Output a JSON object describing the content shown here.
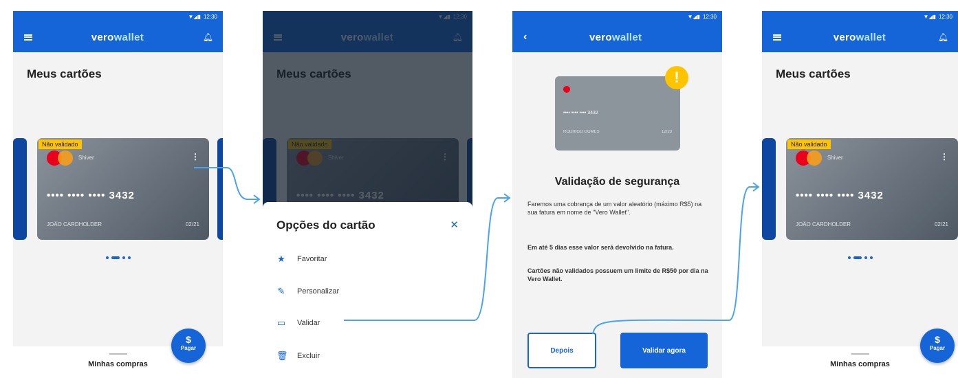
{
  "status": {
    "time": "12:30",
    "icons": "▼◢▮"
  },
  "brand": {
    "logo_a": "vero",
    "logo_b": "wallet"
  },
  "cards_screen": {
    "title": "Meus cartões",
    "card": {
      "badge": "Não validado",
      "brand_text": "Shiver",
      "number": "•••• •••• •••• 3432",
      "holder": "JOÃO CARDHOLDER",
      "expiry": "02/21"
    },
    "bottom_label": "Minhas compras",
    "fab_symbol": "$",
    "fab_label": "Pagar"
  },
  "options_sheet": {
    "title": "Opções do cartão",
    "close": "✕",
    "options": [
      {
        "icon": "star-icon",
        "label": "Favoritar"
      },
      {
        "icon": "pencil-icon",
        "label": "Personalizar"
      },
      {
        "icon": "card-icon",
        "label": "Validar"
      },
      {
        "icon": "trash-icon",
        "label": "Excluir"
      }
    ]
  },
  "validation": {
    "card_number": "•••• •••• •••• 3432",
    "card_holder": "RODRIGO GOMES",
    "card_expiry": "12/23",
    "warning_symbol": "!",
    "title": "Validação de segurança",
    "paragraph1": "Faremos uma cobrança de um valor aleatório (máximo R$5) na sua fatura em nome de \"Vero Wallet\".",
    "paragraph2": "Em até 5 dias esse valor será devolvido na fatura.",
    "paragraph3": "Cartões não validados possuem um limite de R$50 por dia na Vero Wallet.",
    "later_button": "Depois",
    "validate_button": "Validar agora"
  },
  "colors": {
    "primary": "#1565d8",
    "warning": "#ffc400",
    "arrow": "#4aa3ee"
  }
}
